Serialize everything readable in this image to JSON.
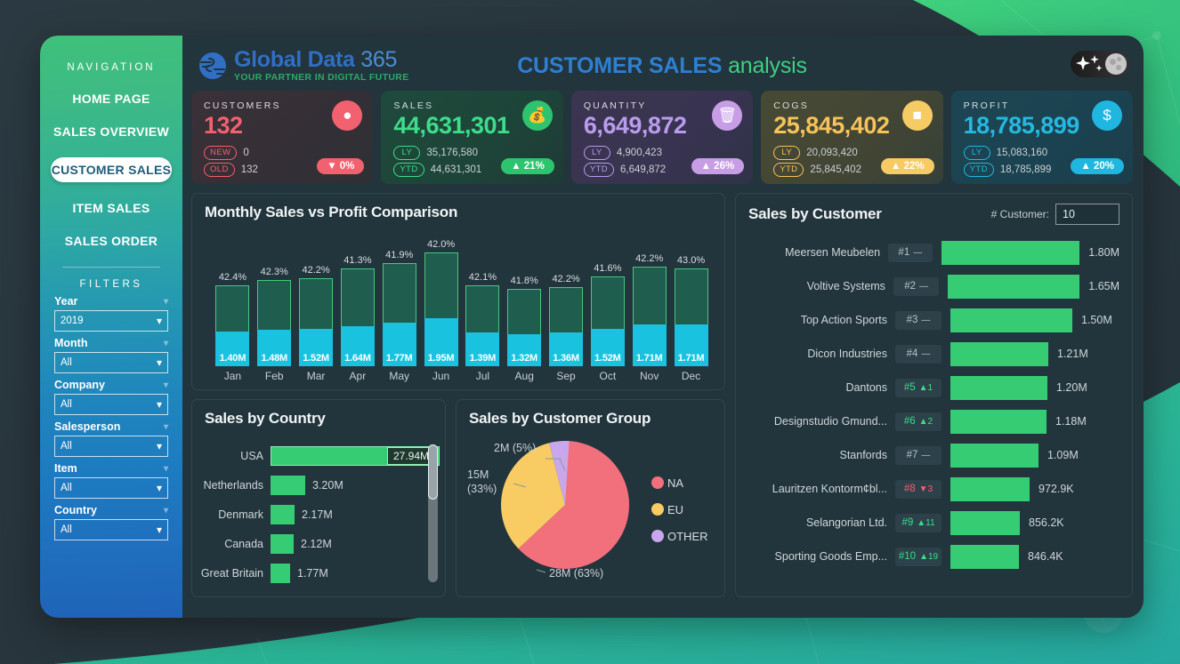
{
  "header": {
    "logo_name": "Global Data",
    "logo_num": "365",
    "logo_tagline": "YOUR PARTNER IN DIGITAL FUTURE",
    "title_a": "CUSTOMER SALES",
    "title_b": "analysis",
    "theme_toggle": "dark-mode-toggle"
  },
  "sidebar": {
    "nav_heading": "NAVIGATION",
    "items": [
      {
        "label": "HOME PAGE",
        "active": false
      },
      {
        "label": "SALES OVERVIEW",
        "active": false
      },
      {
        "label": "CUSTOMER SALES",
        "active": true
      },
      {
        "label": "ITEM SALES",
        "active": false
      },
      {
        "label": "SALES ORDER",
        "active": false
      }
    ],
    "filters_heading": "FILTERS",
    "filters": [
      {
        "label": "Year",
        "value": "2019"
      },
      {
        "label": "Month",
        "value": "All"
      },
      {
        "label": "Company",
        "value": "All"
      },
      {
        "label": "Salesperson",
        "value": "All"
      },
      {
        "label": "Item",
        "value": "All"
      },
      {
        "label": "Country",
        "value": "All"
      }
    ]
  },
  "kpis": [
    {
      "label": "CUSTOMERS",
      "value": "132",
      "value_color": "#f2616f",
      "icon": "user-icon",
      "icon_glyph": "●",
      "icon_bg": "#f2616f",
      "rows": [
        {
          "tag": "NEW",
          "val": "0"
        },
        {
          "tag": "OLD",
          "val": "132"
        }
      ],
      "badge": "▼ 0%",
      "badge_bg": "#f2616f",
      "card_bg": "linear-gradient(135deg,#3a3038 0%,#342f36 60%,#2e3034 100%)"
    },
    {
      "label": "SALES",
      "value": "44,631,301",
      "value_color": "#3ddd8a",
      "icon": "money-bag-icon",
      "icon_glyph": "💰",
      "icon_bg": "#2ec46f",
      "rows": [
        {
          "tag": "LY",
          "val": "35,176,580"
        },
        {
          "tag": "YTD",
          "val": "44,631,301"
        }
      ],
      "badge": "▲ 21%",
      "badge_bg": "#2ec46f",
      "card_bg": "linear-gradient(135deg,#1e4a3c 0%,#1d4438 60%,#1f3a36 100%)"
    },
    {
      "label": "QUANTITY",
      "value": "6,649,872",
      "value_color": "#b99ced",
      "icon": "basket-icon",
      "icon_glyph": "🗑",
      "icon_bg": "#c79ee6",
      "rows": [
        {
          "tag": "LY",
          "val": "4,900,423"
        },
        {
          "tag": "YTD",
          "val": "6,649,872"
        }
      ],
      "badge": "▲ 26%",
      "badge_bg": "#c79ee6",
      "card_bg": "linear-gradient(135deg,#3b3550 0%,#383350 60%,#2f3348 100%)"
    },
    {
      "label": "COGS",
      "value": "25,845,402",
      "value_color": "#f5c35a",
      "icon": "wallet-icon",
      "icon_glyph": "■",
      "icon_bg": "#f7cb64",
      "rows": [
        {
          "tag": "LY",
          "val": "20,093,420"
        },
        {
          "tag": "YTD",
          "val": "25,845,402"
        }
      ],
      "badge": "▲ 22%",
      "badge_bg": "#f7cb64",
      "card_bg": "linear-gradient(135deg,#474a34 0%,#424534 60%,#35403a 100%)"
    },
    {
      "label": "PROFIT",
      "value": "18,785,899",
      "value_color": "#25b8e0",
      "icon": "dollar-badge-icon",
      "icon_glyph": "$",
      "icon_bg": "#1fb6e0",
      "rows": [
        {
          "tag": "LY",
          "val": "15,083,160"
        },
        {
          "tag": "YTD",
          "val": "18,785,899"
        }
      ],
      "badge": "▲ 20%",
      "badge_bg": "#1fb6e0",
      "card_bg": "linear-gradient(135deg,#1c4552 0%,#1b4250 60%,#1c3e4c 100%)"
    }
  ],
  "chart_data": [
    {
      "type": "bar",
      "title": "Monthly Sales vs Profit Comparison",
      "categories": [
        "Jan",
        "Feb",
        "Mar",
        "Apr",
        "May",
        "Jun",
        "Jul",
        "Aug",
        "Sep",
        "Oct",
        "Nov",
        "Dec"
      ],
      "series": [
        {
          "name": "Profit",
          "labels": [
            "1.40M",
            "1.48M",
            "1.52M",
            "1.64M",
            "1.77M",
            "1.95M",
            "1.39M",
            "1.32M",
            "1.36M",
            "1.52M",
            "1.71M",
            "1.71M"
          ],
          "values": [
            1.4,
            1.48,
            1.52,
            1.64,
            1.77,
            1.95,
            1.39,
            1.32,
            1.36,
            1.52,
            1.71,
            1.71
          ],
          "color": "#19c3e0"
        },
        {
          "name": "Sales",
          "values": [
            3.3,
            3.5,
            3.6,
            3.97,
            4.22,
            4.64,
            3.3,
            3.16,
            3.22,
            3.65,
            4.05,
            3.98
          ],
          "color": "#1f5d4f"
        }
      ],
      "pct_labels": [
        "42.4%",
        "42.3%",
        "42.2%",
        "41.3%",
        "41.9%",
        "42.0%",
        "42.1%",
        "41.8%",
        "42.2%",
        "41.6%",
        "42.2%",
        "43.0%"
      ],
      "xlabel": "",
      "ylabel": "",
      "grid": false,
      "legend": "none"
    },
    {
      "type": "bar",
      "title": "Sales by Country",
      "orientation": "horizontal",
      "categories": [
        "USA",
        "Netherlands",
        "Denmark",
        "Canada",
        "Great Britain"
      ],
      "labels": [
        "27.94M",
        "3.20M",
        "2.17M",
        "2.12M",
        "1.77M"
      ],
      "values": [
        27.94,
        3.2,
        2.17,
        2.12,
        1.77
      ],
      "color": "#36cc74",
      "highlight_index": 0,
      "scrollbar": true
    },
    {
      "type": "pie",
      "title": "Sales by Customer Group",
      "slices": [
        {
          "name": "NA",
          "label": "28M (63%)",
          "value": 63,
          "color": "#f2707c"
        },
        {
          "name": "EU",
          "label": "15M (33%)",
          "value": 33,
          "color": "#f8cb63"
        },
        {
          "name": "OTHER",
          "label": "2M (5%)",
          "value": 5,
          "color": "#c9a7ed"
        }
      ],
      "legend": [
        "NA",
        "EU",
        "OTHER"
      ],
      "legend_position": "right"
    },
    {
      "type": "bar",
      "title": "Sales by Customer",
      "orientation": "horizontal",
      "categories": [
        "Meersen Meubelen",
        "Voltive Systems",
        "Top Action Sports",
        "Dicon Industries",
        "Dantons",
        "Designstudio Gmund...",
        "Stanfords",
        "Lauritzen Kontorm¢bl...",
        "Selangorian Ltd.",
        "Sporting Goods Emp..."
      ],
      "labels": [
        "1.80M",
        "1.65M",
        "1.50M",
        "1.21M",
        "1.20M",
        "1.18M",
        "1.09M",
        "972.9K",
        "856.2K",
        "846.4K"
      ],
      "values": [
        1.8,
        1.65,
        1.5,
        1.21,
        1.2,
        1.18,
        1.09,
        0.9729,
        0.8562,
        0.8464
      ],
      "color": "#36cc74",
      "ranks": [
        {
          "rank": "#1",
          "delta": "—",
          "dir": "flat"
        },
        {
          "rank": "#2",
          "delta": "—",
          "dir": "flat"
        },
        {
          "rank": "#3",
          "delta": "—",
          "dir": "flat"
        },
        {
          "rank": "#4",
          "delta": "—",
          "dir": "flat"
        },
        {
          "rank": "#5",
          "delta": "▲1",
          "dir": "up"
        },
        {
          "rank": "#6",
          "delta": "▲2",
          "dir": "up"
        },
        {
          "rank": "#7",
          "delta": "—",
          "dir": "flat"
        },
        {
          "rank": "#8",
          "delta": "▼3",
          "dir": "down"
        },
        {
          "rank": "#9",
          "delta": "▲11",
          "dir": "up"
        },
        {
          "rank": "#10",
          "delta": "▲19",
          "dir": "up"
        }
      ]
    }
  ],
  "customer_panel": {
    "count_label": "# Customer:",
    "count_value": "10"
  },
  "colors": {
    "accent_green": "#36cc74",
    "accent_blue": "#2f7fd0",
    "cyan": "#19c3e0",
    "panel_bg": "#22343c",
    "app_bg": "#22343c"
  }
}
